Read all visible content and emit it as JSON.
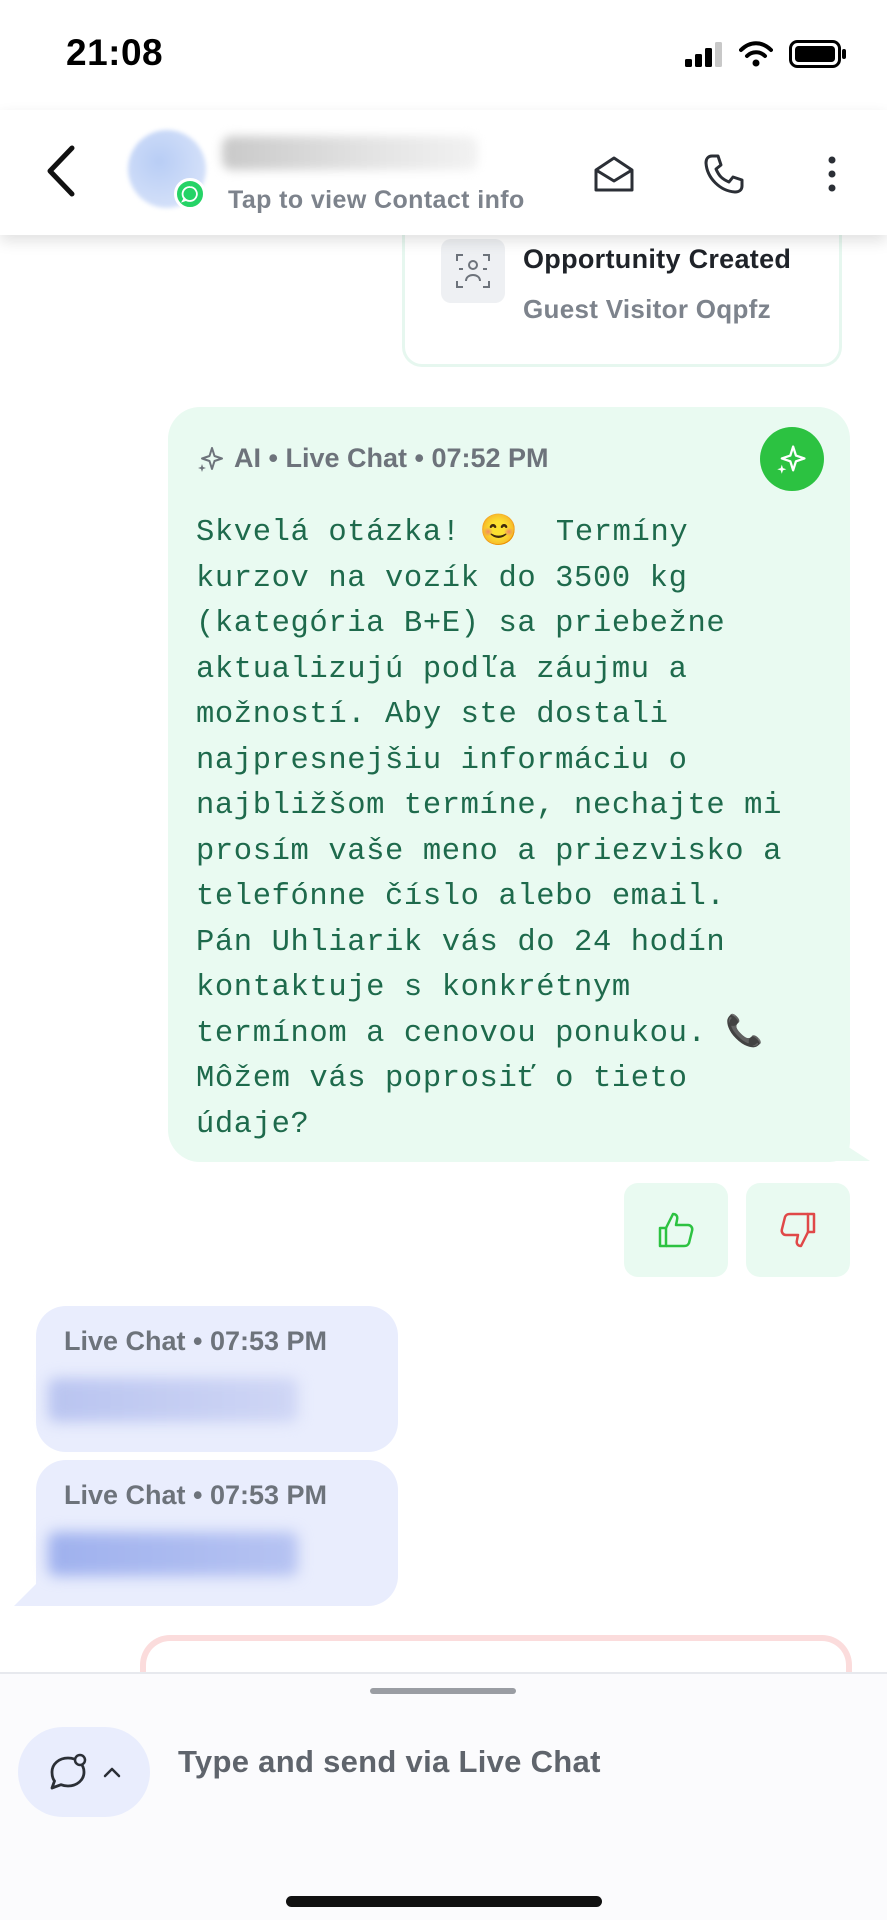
{
  "status_bar": {
    "time": "21:08"
  },
  "header": {
    "contact_subtitle": "Tap to view Contact info",
    "icons": [
      "back-arrow-icon",
      "email-icon",
      "phone-icon",
      "more-vertical-icon"
    ]
  },
  "opportunity": {
    "title": "Opportunity Created",
    "subtitle": "Guest Visitor Oqpfz"
  },
  "ai_message": {
    "meta": "AI • Live Chat • 07:52 PM",
    "text": "Skvelá otázka! 😊  Termíny\nkurzov na vozík do 3500 kg\n(kategória B+E) sa priebežne\naktualizujú podľa záujmu a\nmožností. Aby ste dostali\nnajpresnejšiu informáciu o\nnajbližšom termíne, nechajte mi\nprosím vaše meno a priezvisko a\ntelefónne číslo alebo email.\nPán Uhliarik vás do 24 hodín\nkontaktuje s konkrétnym\ntermínom a cenovou ponukou. 📞\nMôžem vás poprosiť o tieto\núdaje?"
  },
  "incoming_messages": [
    {
      "meta": "Live Chat • 07:53 PM"
    },
    {
      "meta": "Live Chat • 07:53 PM"
    }
  ],
  "composer": {
    "placeholder": "Type and send via Live Chat"
  },
  "colors": {
    "ai_bubble": "#e9faf1",
    "ai_text": "#1e6a4c",
    "accent_green": "#2cc241",
    "incoming_bubble": "#e9edfd",
    "thumbs_down": "#e04848"
  }
}
